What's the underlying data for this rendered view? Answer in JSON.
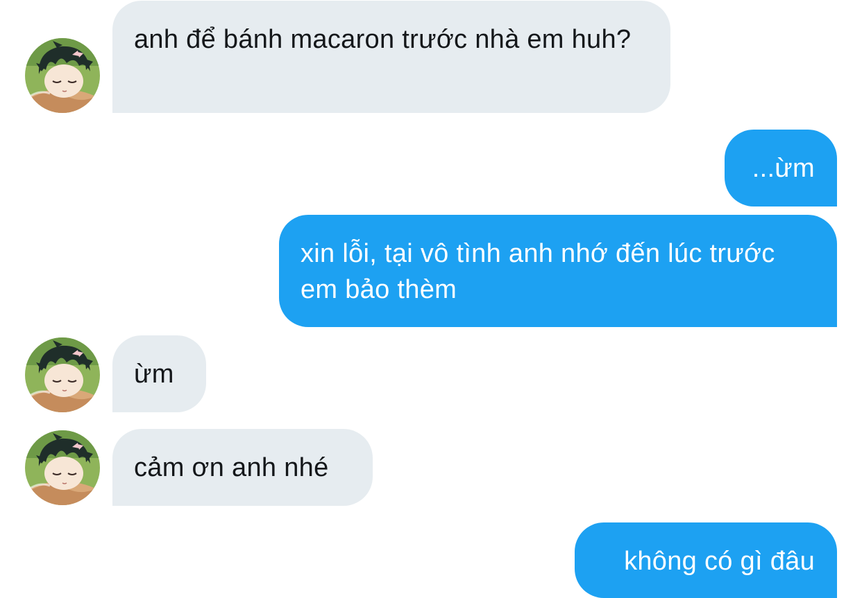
{
  "conversation": {
    "messages": [
      {
        "sender": "them",
        "text": "anh để bánh macaron trước nhà em huh?",
        "avatar": "anime-boy-sleeping-avatar"
      },
      {
        "sender": "me",
        "text": "...ừm"
      },
      {
        "sender": "me",
        "text": "xin lỗi, tại vô tình anh nhớ đến lúc trước em bảo thèm"
      },
      {
        "sender": "them",
        "text": "ừm",
        "avatar": "anime-boy-sleeping-avatar"
      },
      {
        "sender": "them",
        "text": "cảm ơn anh nhé",
        "avatar": "anime-boy-sleeping-avatar"
      },
      {
        "sender": "me",
        "text": "không có gì đâu"
      }
    ]
  },
  "colors": {
    "incoming_bubble": "#e6ecf0",
    "incoming_text": "#14171a",
    "outgoing_bubble": "#1da1f2",
    "outgoing_text": "#ffffff",
    "background": "#ffffff"
  }
}
